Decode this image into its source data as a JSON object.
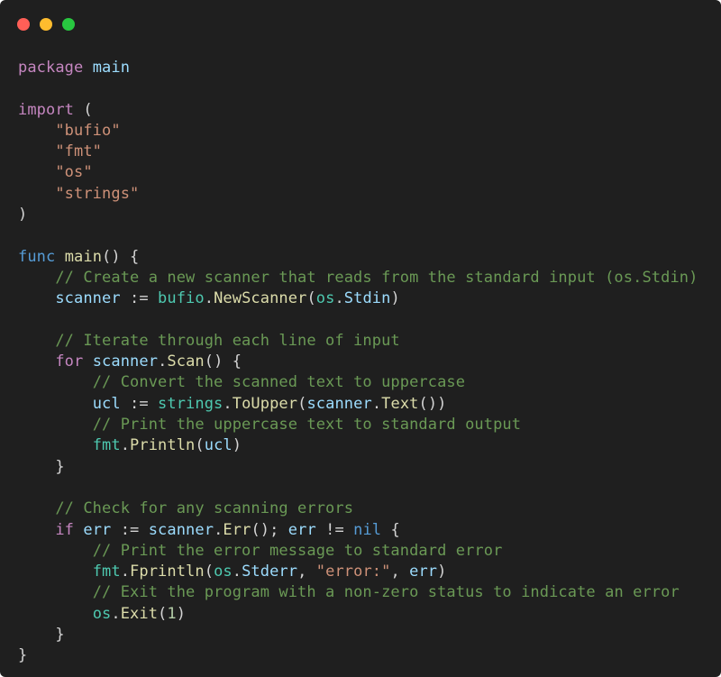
{
  "window": {
    "controls": {
      "close_color": "#ff5f57",
      "minimize_color": "#febc2e",
      "maximize_color": "#28c840"
    }
  },
  "code": {
    "language": "go",
    "lines": [
      [
        {
          "t": "kw",
          "v": "package"
        },
        {
          "t": "punc",
          "v": " "
        },
        {
          "t": "id",
          "v": "main"
        }
      ],
      [],
      [
        {
          "t": "kw",
          "v": "import"
        },
        {
          "t": "punc",
          "v": " ("
        }
      ],
      [
        {
          "t": "punc",
          "v": "    "
        },
        {
          "t": "str",
          "v": "\"bufio\""
        }
      ],
      [
        {
          "t": "punc",
          "v": "    "
        },
        {
          "t": "str",
          "v": "\"fmt\""
        }
      ],
      [
        {
          "t": "punc",
          "v": "    "
        },
        {
          "t": "str",
          "v": "\"os\""
        }
      ],
      [
        {
          "t": "punc",
          "v": "    "
        },
        {
          "t": "str",
          "v": "\"strings\""
        }
      ],
      [
        {
          "t": "punc",
          "v": ")"
        }
      ],
      [],
      [
        {
          "t": "kw2",
          "v": "func"
        },
        {
          "t": "punc",
          "v": " "
        },
        {
          "t": "fn",
          "v": "main"
        },
        {
          "t": "punc",
          "v": "() {"
        }
      ],
      [
        {
          "t": "punc",
          "v": "    "
        },
        {
          "t": "com",
          "v": "// Create a new scanner that reads from the standard input (os.Stdin)"
        }
      ],
      [
        {
          "t": "punc",
          "v": "    "
        },
        {
          "t": "id",
          "v": "scanner"
        },
        {
          "t": "punc",
          "v": " := "
        },
        {
          "t": "pkg",
          "v": "bufio"
        },
        {
          "t": "punc",
          "v": "."
        },
        {
          "t": "fn",
          "v": "NewScanner"
        },
        {
          "t": "punc",
          "v": "("
        },
        {
          "t": "pkg",
          "v": "os"
        },
        {
          "t": "punc",
          "v": "."
        },
        {
          "t": "id",
          "v": "Stdin"
        },
        {
          "t": "punc",
          "v": ")"
        }
      ],
      [],
      [
        {
          "t": "punc",
          "v": "    "
        },
        {
          "t": "com",
          "v": "// Iterate through each line of input"
        }
      ],
      [
        {
          "t": "punc",
          "v": "    "
        },
        {
          "t": "kw",
          "v": "for"
        },
        {
          "t": "punc",
          "v": " "
        },
        {
          "t": "id",
          "v": "scanner"
        },
        {
          "t": "punc",
          "v": "."
        },
        {
          "t": "fn",
          "v": "Scan"
        },
        {
          "t": "punc",
          "v": "() {"
        }
      ],
      [
        {
          "t": "punc",
          "v": "        "
        },
        {
          "t": "com",
          "v": "// Convert the scanned text to uppercase"
        }
      ],
      [
        {
          "t": "punc",
          "v": "        "
        },
        {
          "t": "id",
          "v": "ucl"
        },
        {
          "t": "punc",
          "v": " := "
        },
        {
          "t": "pkg",
          "v": "strings"
        },
        {
          "t": "punc",
          "v": "."
        },
        {
          "t": "fn",
          "v": "ToUpper"
        },
        {
          "t": "punc",
          "v": "("
        },
        {
          "t": "id",
          "v": "scanner"
        },
        {
          "t": "punc",
          "v": "."
        },
        {
          "t": "fn",
          "v": "Text"
        },
        {
          "t": "punc",
          "v": "())"
        }
      ],
      [
        {
          "t": "punc",
          "v": "        "
        },
        {
          "t": "com",
          "v": "// Print the uppercase text to standard output"
        }
      ],
      [
        {
          "t": "punc",
          "v": "        "
        },
        {
          "t": "pkg",
          "v": "fmt"
        },
        {
          "t": "punc",
          "v": "."
        },
        {
          "t": "fn",
          "v": "Println"
        },
        {
          "t": "punc",
          "v": "("
        },
        {
          "t": "id",
          "v": "ucl"
        },
        {
          "t": "punc",
          "v": ")"
        }
      ],
      [
        {
          "t": "punc",
          "v": "    }"
        }
      ],
      [],
      [
        {
          "t": "punc",
          "v": "    "
        },
        {
          "t": "com",
          "v": "// Check for any scanning errors"
        }
      ],
      [
        {
          "t": "punc",
          "v": "    "
        },
        {
          "t": "kw",
          "v": "if"
        },
        {
          "t": "punc",
          "v": " "
        },
        {
          "t": "id",
          "v": "err"
        },
        {
          "t": "punc",
          "v": " := "
        },
        {
          "t": "id",
          "v": "scanner"
        },
        {
          "t": "punc",
          "v": "."
        },
        {
          "t": "fn",
          "v": "Err"
        },
        {
          "t": "punc",
          "v": "(); "
        },
        {
          "t": "id",
          "v": "err"
        },
        {
          "t": "punc",
          "v": " != "
        },
        {
          "t": "nil",
          "v": "nil"
        },
        {
          "t": "punc",
          "v": " {"
        }
      ],
      [
        {
          "t": "punc",
          "v": "        "
        },
        {
          "t": "com",
          "v": "// Print the error message to standard error"
        }
      ],
      [
        {
          "t": "punc",
          "v": "        "
        },
        {
          "t": "pkg",
          "v": "fmt"
        },
        {
          "t": "punc",
          "v": "."
        },
        {
          "t": "fn",
          "v": "Fprintln"
        },
        {
          "t": "punc",
          "v": "("
        },
        {
          "t": "pkg",
          "v": "os"
        },
        {
          "t": "punc",
          "v": "."
        },
        {
          "t": "id",
          "v": "Stderr"
        },
        {
          "t": "punc",
          "v": ", "
        },
        {
          "t": "str",
          "v": "\"error:\""
        },
        {
          "t": "punc",
          "v": ", "
        },
        {
          "t": "id",
          "v": "err"
        },
        {
          "t": "punc",
          "v": ")"
        }
      ],
      [
        {
          "t": "punc",
          "v": "        "
        },
        {
          "t": "com",
          "v": "// Exit the program with a non-zero status to indicate an error"
        }
      ],
      [
        {
          "t": "punc",
          "v": "        "
        },
        {
          "t": "pkg",
          "v": "os"
        },
        {
          "t": "punc",
          "v": "."
        },
        {
          "t": "fn",
          "v": "Exit"
        },
        {
          "t": "punc",
          "v": "("
        },
        {
          "t": "num",
          "v": "1"
        },
        {
          "t": "punc",
          "v": ")"
        }
      ],
      [
        {
          "t": "punc",
          "v": "    }"
        }
      ],
      [
        {
          "t": "punc",
          "v": "}"
        }
      ]
    ]
  }
}
